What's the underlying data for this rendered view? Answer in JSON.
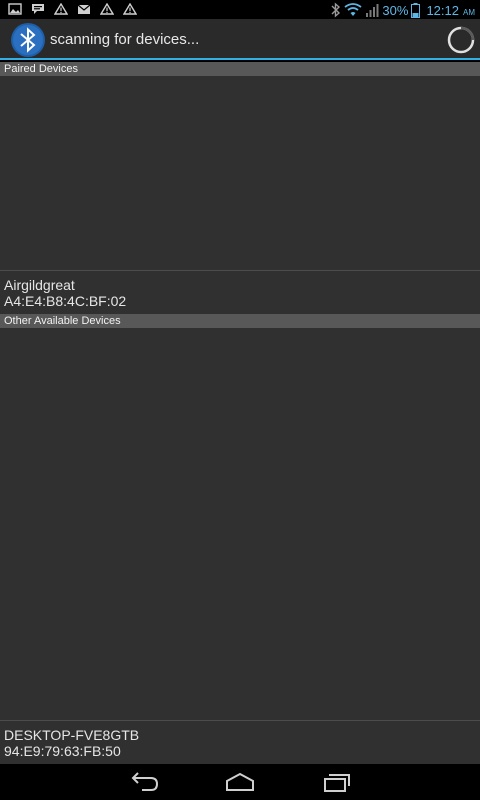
{
  "status_bar": {
    "notification_icons": [
      "image-icon",
      "chat-icon",
      "warning-icon",
      "mail-icon",
      "warning-icon",
      "warning-icon"
    ],
    "battery_percent": "30%",
    "time": "12:12",
    "am_pm": "AM",
    "accent_color": "#5fb6e6"
  },
  "action_bar": {
    "title": "scanning for devices...",
    "accent_color": "#32b0e6"
  },
  "paired_section": {
    "header": "Paired Devices",
    "devices": [
      {
        "name": "Airgildgreat",
        "address": "A4:E4:B8:4C:BF:02"
      }
    ]
  },
  "available_section": {
    "header": "Other Available Devices",
    "devices": [
      {
        "name": "DESKTOP-FVE8GTB",
        "address": "94:E9:79:63:FB:50"
      }
    ]
  },
  "nav_bar": {
    "buttons": [
      "back-icon",
      "home-icon",
      "recents-icon"
    ]
  }
}
